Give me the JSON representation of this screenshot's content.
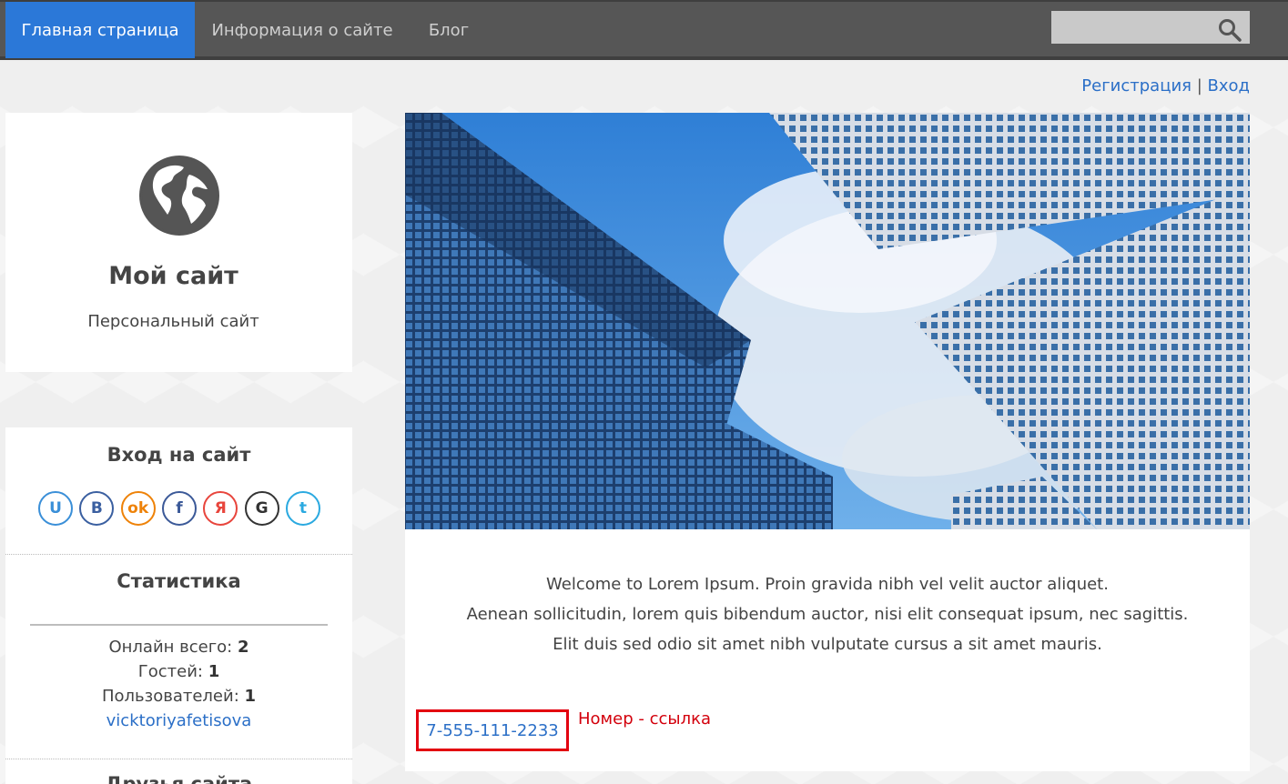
{
  "nav": {
    "home": "Главная страница",
    "info": "Информация о сайте",
    "blog": "Блог"
  },
  "search": {
    "placeholder": "",
    "icon": "search-icon"
  },
  "auth": {
    "register": "Регистрация",
    "separator": "|",
    "login": "Вход"
  },
  "site": {
    "icon": "globe-icon",
    "title": "Мой сайт",
    "subtitle": "Персональный сайт"
  },
  "login_panel": {
    "heading": "Вход на сайт",
    "socials": [
      {
        "label": "U",
        "color": "#3a8fd8",
        "icon": "ucoz-icon"
      },
      {
        "label": "B",
        "color": "#3a5fa0",
        "icon": "vk-icon"
      },
      {
        "label": "ok",
        "color": "#ee8208",
        "icon": "odnoklassniki-icon"
      },
      {
        "label": "f",
        "color": "#3b5998",
        "icon": "facebook-icon"
      },
      {
        "label": "Я",
        "color": "#e8453c",
        "icon": "yandex-icon"
      },
      {
        "label": "G",
        "color": "#333333",
        "icon": "google-icon"
      },
      {
        "label": "t",
        "color": "#2aa9e0",
        "icon": "twitter-icon"
      }
    ]
  },
  "stats": {
    "heading": "Статистика",
    "online_label": "Онлайн всего:",
    "online_value": "2",
    "guests_label": "Гостей:",
    "guests_value": "1",
    "users_label": "Пользователей:",
    "users_value": "1",
    "user_link": "vicktoriyafetisova"
  },
  "friends": {
    "heading": "Друзья сайта"
  },
  "content": {
    "welcome_1": "Welcome to Lorem Ipsum. Proin gravida nibh vel velit auctor aliquet.",
    "welcome_2": "Aenean sollicitudin, lorem quis bibendum auctor, nisi elit consequat ipsum, nec sagittis.",
    "welcome_3": "Elit duis sed odio sit amet nibh vulputate cursus a sit amet mauris.",
    "phone": "7-555-111-2233",
    "note": "Номер - ссылка"
  },
  "colors": {
    "nav_active": "#2b78d8",
    "link": "#2b6fc7",
    "highlight": "#e3000f"
  }
}
